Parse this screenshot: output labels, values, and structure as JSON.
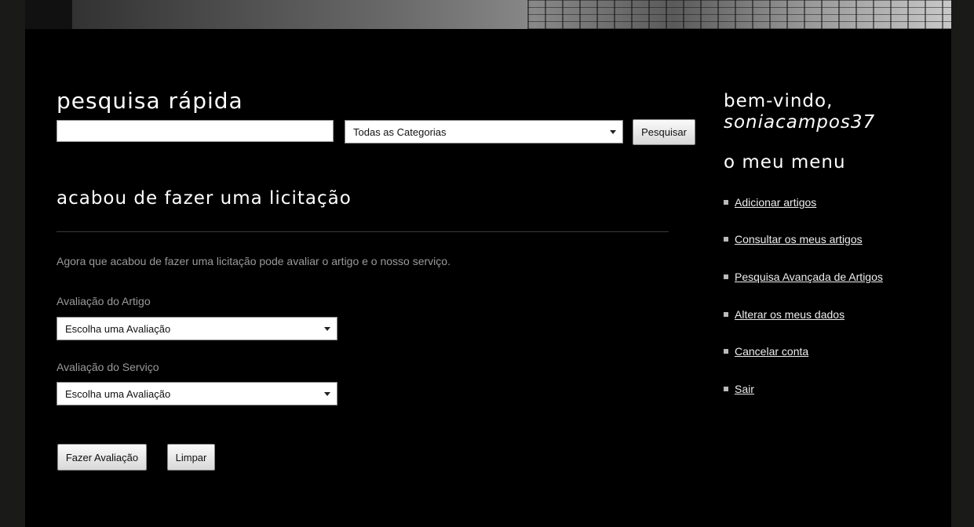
{
  "quick_search": {
    "heading": "pesquisa rápida",
    "input_value": "",
    "category_selected": "Todas as Categorias",
    "search_button": "Pesquisar"
  },
  "main": {
    "title": "acabou de fazer uma licitação",
    "intro": "Agora que acabou de fazer uma licitação pode avaliar o artigo e o nosso serviço.",
    "article_rating_label": "Avaliação do Artigo",
    "article_rating_selected": "Escolha uma Avaliação",
    "service_rating_label": "Avaliação do Serviço",
    "service_rating_selected": "Escolha uma Avaliação",
    "submit_button": "Fazer Avaliação",
    "clear_button": "Limpar"
  },
  "sidebar": {
    "welcome": "bem-vindo,",
    "username": "soniacampos37",
    "menu_heading": "o meu menu",
    "items": [
      {
        "label": "Adicionar artigos"
      },
      {
        "label": "Consultar os meus artigos"
      },
      {
        "label": "Pesquisa Avançada de Artigos"
      },
      {
        "label": "Alterar os meus dados"
      },
      {
        "label": "Cancelar conta"
      },
      {
        "label": "Sair"
      }
    ]
  }
}
